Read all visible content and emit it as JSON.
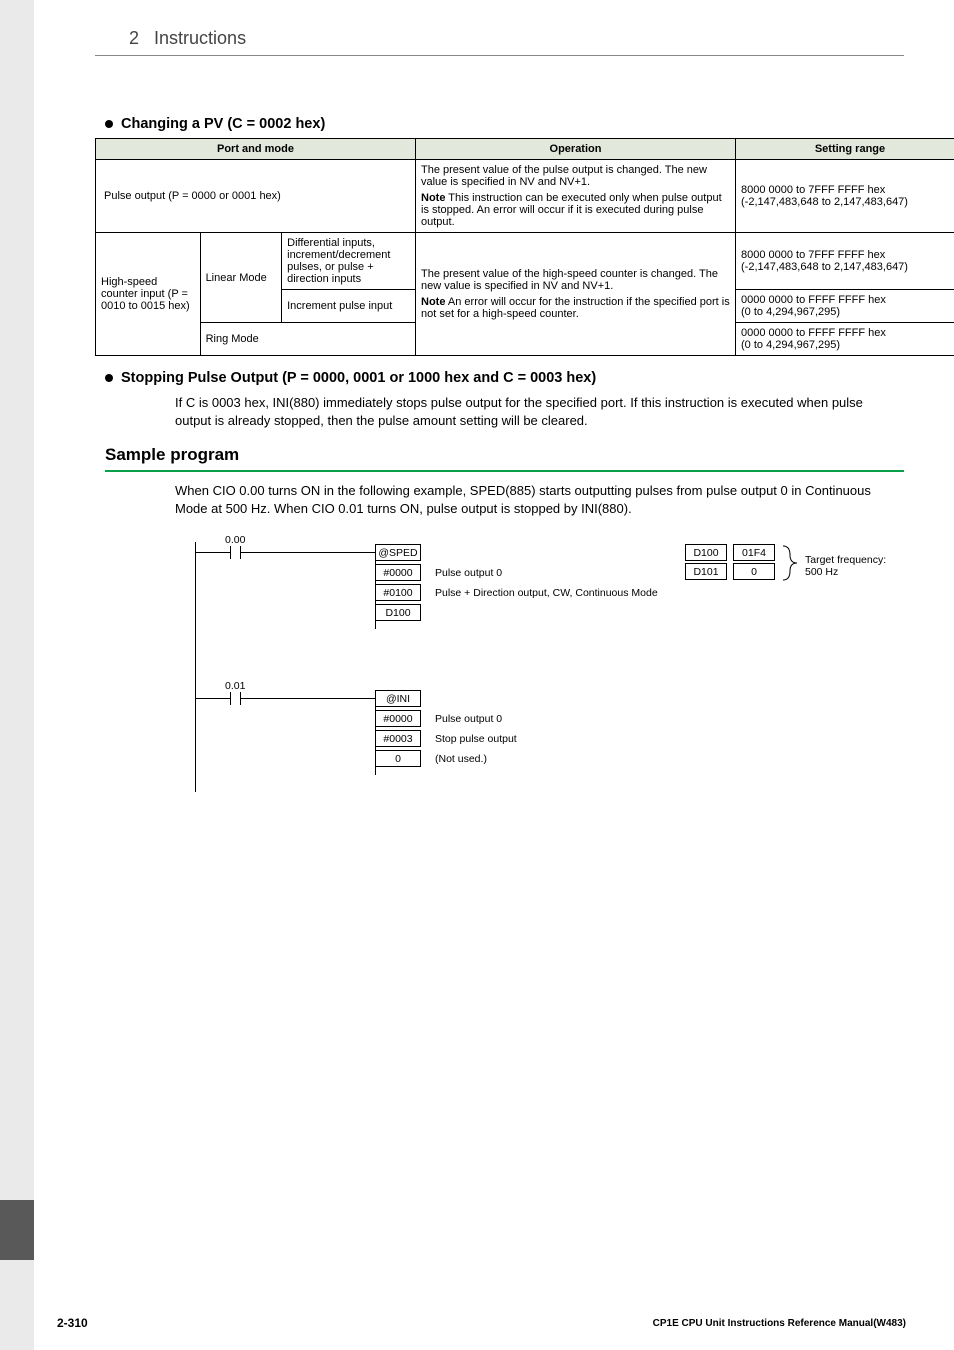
{
  "header": {
    "section_no": "2",
    "section_title": "Instructions"
  },
  "h_bullet_1": "Changing a PV (C = 0002 hex)",
  "h_bullet_2": "Stopping Pulse Output (P = 0000, 0001 or 1000 hex and C = 0003 hex)",
  "h2_sample": "Sample program",
  "para_stop": "If C is 0003 hex, INI(880) immediately stops pulse output for the specified port. If this instruction is executed when pulse output is already stopped, then the pulse amount setting will be cleared.",
  "para_sample": "When CIO 0.00 turns ON in the following example, SPED(885) starts outputting pulses from pulse output 0 in Continuous Mode at 500 Hz. When CIO 0.01 turns ON, pulse output is stopped by INI(880).",
  "table": {
    "headers": [
      "Port and mode",
      "Operation",
      "Setting range"
    ],
    "r1": {
      "port": "Pulse output (P = 0000 or 0001 hex)",
      "op_top": "The present value of the pulse output is changed. The new value is specified in NV and NV+1.",
      "op_note_lbl": "Note",
      "op_note": " This instruction can be executed only when pulse output is stopped. An error will occur if it is executed during pulse output.",
      "range1": "8000 0000 to 7FFF FFFF hex",
      "range2": "(-2,147,483,648 to 2,147,483,647)"
    },
    "r2": {
      "port_l": "High-speed counter input (P = 0010 to 0015 hex)",
      "mode_lin": "Linear Mode",
      "input_diff": "Differential inputs, increment/decrement pulses, or pulse + direction inputs",
      "input_inc": "Increment pulse input",
      "mode_ring": "Ring Mode",
      "op_top": "The present value of the high-speed counter is changed. The new value is specified in NV and NV+1.",
      "op_note_lbl": "Note",
      "op_note": " An error will occur for the instruction if the specified port is not set for a high-speed counter.",
      "rng_a1": "8000 0000 to 7FFF FFFF hex",
      "rng_a2": "(-2,147,483,648 to 2,147,483,647)",
      "rng_b1": "0000 0000 to FFFF FFFF hex",
      "rng_b2": "(0 to 4,294,967,295)",
      "rng_c1": "0000 0000 to FFFF FFFF hex",
      "rng_c2": "(0 to 4,294,967,295)"
    }
  },
  "ladder": {
    "cio0": "0.00",
    "cio1": "0.01",
    "sped": "@SPED",
    "ini": "@INI",
    "a0": "#0000",
    "a1": "#0100",
    "a2": "D100",
    "b0": "#0000",
    "b1": "#0003",
    "b2": "0",
    "d0": "Pulse output 0",
    "d1": "Pulse + Direction output, CW, Continuous Mode",
    "d3": "Pulse output 0",
    "d4": "Stop pulse output",
    "d5": "(Not used.)",
    "reg_d100": "D100",
    "reg_d100v": "01F4",
    "reg_d101": "D101",
    "reg_d101v": "0",
    "tgt": "Target frequency: 500 Hz"
  },
  "footer": {
    "page": "2-310",
    "doc": "CP1E CPU Unit Instructions Reference Manual(W483)"
  }
}
